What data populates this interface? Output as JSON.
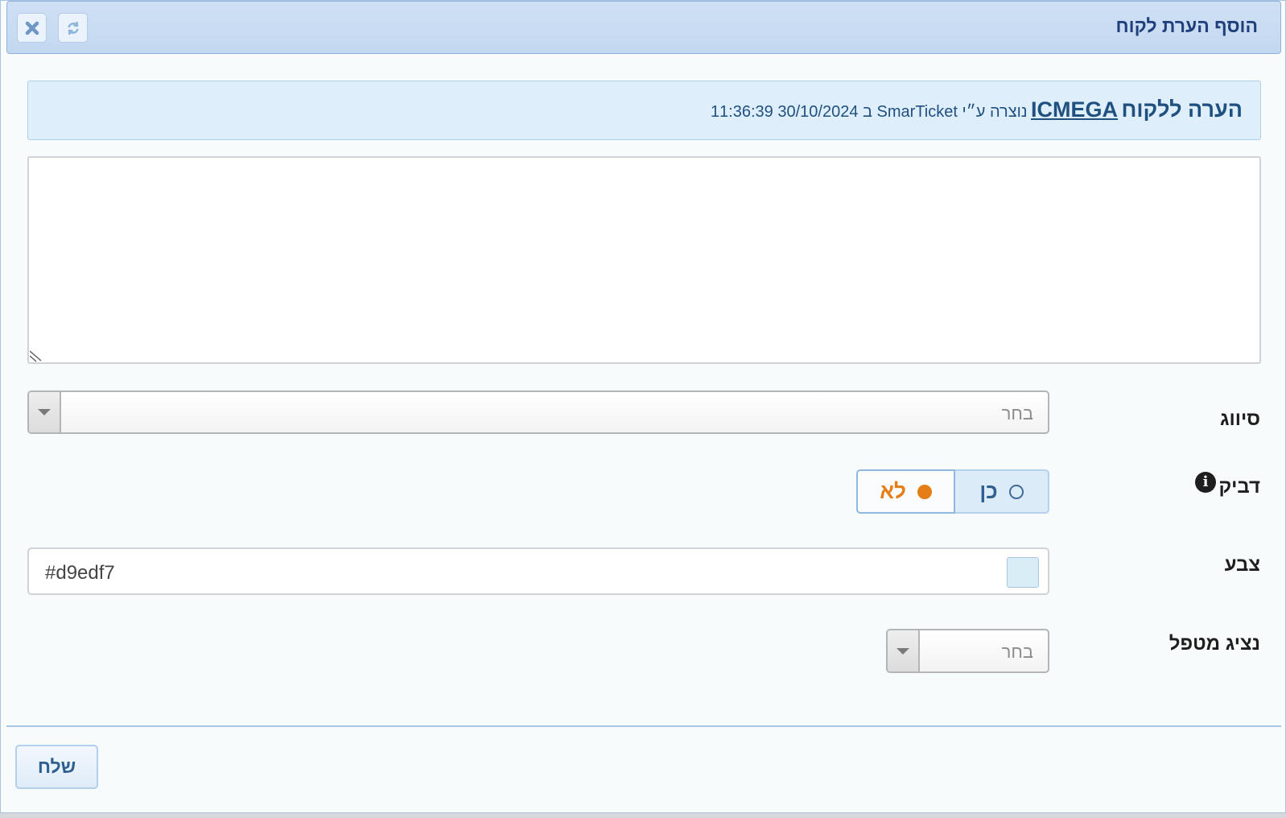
{
  "dialog": {
    "title": "הוסף הערת לקוח",
    "close_icon": "close-icon",
    "refresh_icon": "refresh-icon"
  },
  "banner": {
    "prefix": "הערה ללקוח",
    "customer": "ICMEGA",
    "created_text": "נוצרה ע״י SmarTicket ב 30/10/2024 11:36:39"
  },
  "note": {
    "value": ""
  },
  "fields": {
    "classification": {
      "label": "סיווג",
      "placeholder": "בחר"
    },
    "sticky": {
      "label": "דביק",
      "info_icon": "info-icon",
      "options": [
        "כן",
        "לא"
      ],
      "selected": "לא"
    },
    "color": {
      "label": "צבע",
      "value": "#d9edf7",
      "swatch": "#d9edf7"
    },
    "handler_rep": {
      "label": "נציג מטפל",
      "placeholder": "בחר"
    }
  },
  "footer": {
    "send_label": "שלח"
  }
}
